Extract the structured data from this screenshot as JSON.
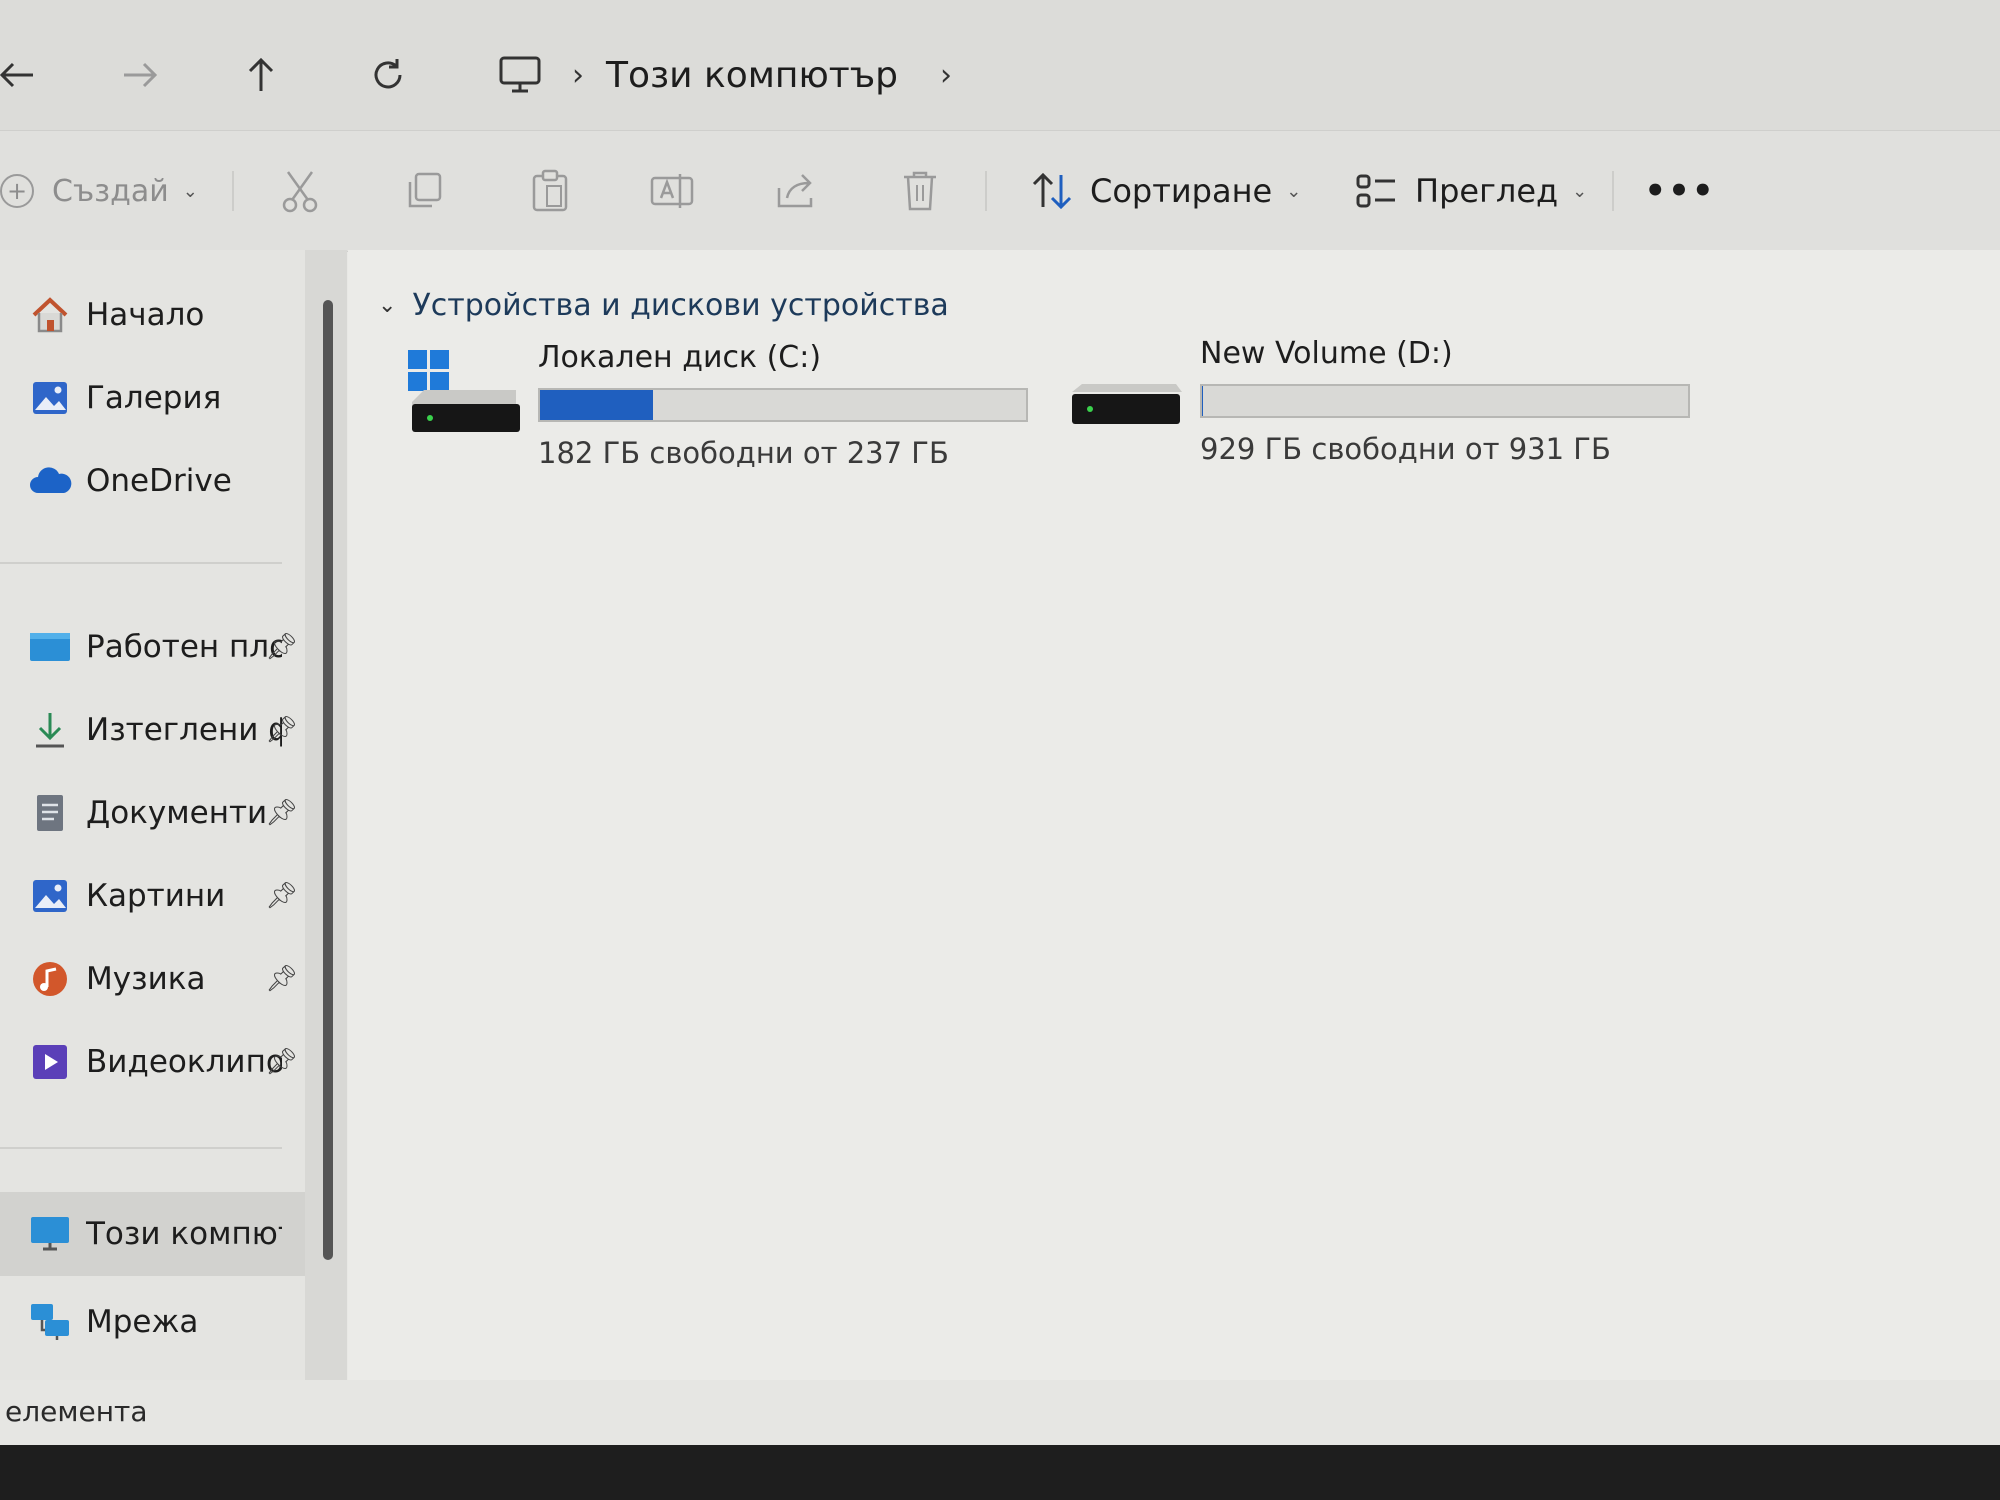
{
  "address_bar": {
    "back_icon": "arrow-left-icon",
    "forward_icon": "arrow-right-icon",
    "up_icon": "arrow-up-icon",
    "refresh_icon": "refresh-icon",
    "separator": "›",
    "location": "Този компютър"
  },
  "toolbar": {
    "create_label": "Създай",
    "sort_label": "Сортиране",
    "view_label": "Преглед",
    "more_label": "•••"
  },
  "sidebar": {
    "items": [
      {
        "label": "Начало",
        "icon": "home-icon"
      },
      {
        "label": "Галерия",
        "icon": "gallery-icon"
      },
      {
        "label": "OneDrive",
        "icon": "cloud-icon"
      },
      {
        "label": "Работен плот",
        "icon": "desktop-icon",
        "pinned": true
      },
      {
        "label": "Изтеглени файлове",
        "icon": "download-icon",
        "pinned": true
      },
      {
        "label": "Документи",
        "icon": "document-icon",
        "pinned": true
      },
      {
        "label": "Картини",
        "icon": "pictures-icon",
        "pinned": true
      },
      {
        "label": "Музика",
        "icon": "music-icon",
        "pinned": true
      },
      {
        "label": "Видеоклипове",
        "icon": "video-icon",
        "pinned": true
      },
      {
        "label": "Този компютър",
        "icon": "computer-icon",
        "selected": true
      },
      {
        "label": "Мрежа",
        "icon": "network-icon"
      }
    ]
  },
  "content": {
    "group_title": "Устройства и дискови устройства",
    "drives": [
      {
        "name": "Локален диск (C:)",
        "free_text": "182 ГБ свободни от 237 ГБ",
        "used_fraction": 0.232,
        "bar_color": "#1f5fbf"
      },
      {
        "name": "New Volume (D:)",
        "free_text": "929 ГБ свободни от 931 ГБ",
        "used_fraction": 0.002,
        "bar_color": "#1f5fbf"
      }
    ]
  },
  "status_bar": {
    "text": "елемента"
  }
}
